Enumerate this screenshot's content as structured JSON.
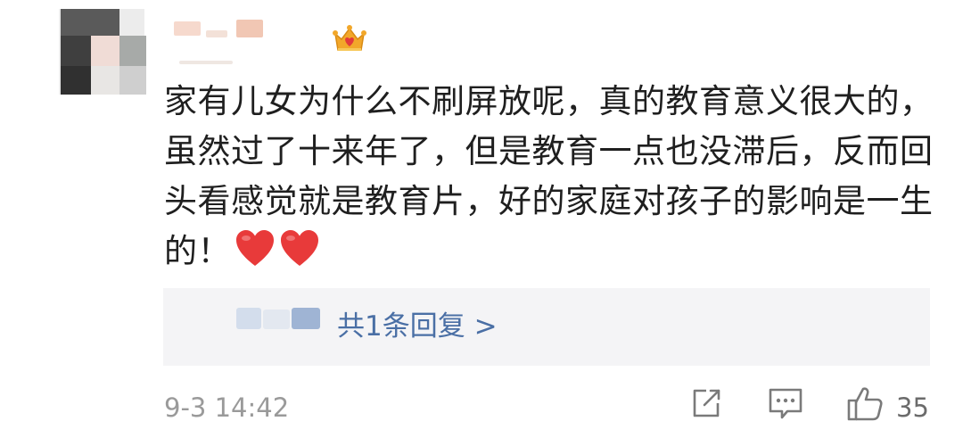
{
  "comment": {
    "text": "家有儿女为什么不刷屏放呢，真的教育意义很大的，虽然过了十来年了，但是教育一点也没滞后，反而回头看感觉就是教育片，好的家庭对孩子的影响是一生的！",
    "emoji": [
      "red-heart",
      "red-heart"
    ],
    "badge": "crown-icon"
  },
  "reply": {
    "label": "共1条回复 >"
  },
  "meta": {
    "timestamp": "9-3 14:42",
    "likes": "35"
  },
  "icons": {
    "share": "share-icon",
    "comment": "comment-icon",
    "like": "thumbs-up-icon"
  },
  "colors": {
    "text": "#1f1f1f",
    "link": "#4a6fa5",
    "meta": "#9a9a9a",
    "reply_bg": "#f4f4f6",
    "heart": "#e83a3a",
    "crown": "#f2a72a"
  }
}
